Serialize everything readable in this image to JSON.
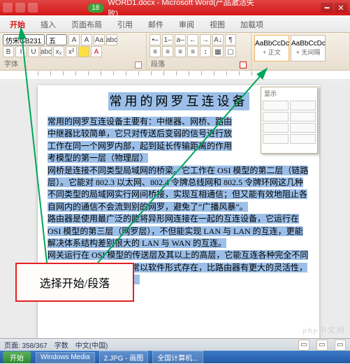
{
  "title": {
    "badge": "18",
    "doc": "WORD1.docx - Microsoft Word(产品激活失败)"
  },
  "tabs": [
    "开始",
    "插入",
    "页面布局",
    "引用",
    "邮件",
    "审阅",
    "视图",
    "加载项"
  ],
  "font": {
    "name": "仿宋GB2312",
    "size": "五"
  },
  "rbtn": {
    "b": "B",
    "i": "I",
    "u": "U",
    "s": "abc",
    "x2": "x²",
    "x1": "x₂",
    "clr": "abc",
    "aa": "Aa",
    "al": "≡",
    "ac": "≡",
    "ar": "≡",
    "aj": "≡",
    "bl": "•–",
    "nl": "1–",
    "il": "a–",
    "sh": "▦",
    "bd": "▢",
    "a1": "A",
    "a2": "A"
  },
  "group_labels": {
    "font": "字体",
    "para": "段落"
  },
  "styles": [
    {
      "preview": "AaBbCcDc",
      "name": "+ 正文"
    },
    {
      "preview": "AaBbCcDc",
      "name": "+ 无间隔"
    }
  ],
  "float_hdr": "显示",
  "doc": {
    "title": "常用的网罗互连设备",
    "p1": "常用的网罗互连设备主要有：中继器、网桥、路由",
    "p2": "中继器比较简单，它只对传送后变弱的信号进行放",
    "p3": "工作在同一个网罗内部，起到延长传输距离的作用",
    "p4": "考模型的第一层（物理层）",
    "p5": "网桥是连接不同类型局域网的桥梁。它工作在 OSI 模型的第二层（链路层）。它能对 802.3 以太网、802.4 令牌总线网和 802.5 令牌环网这几种不同类型的局域网实行网间桥接，实现互相通信；但又能有效地阻止各自网内的通信不会流到别的网罗，避免了“广播风暴”。",
    "p6": "路由器是使用最广泛的能将异形网连接在一起的互连设备，它运行在 OSI 模型的第三层（网罗层），不但能实现 LAN 与 LAN 的互连，更能解决体系结构差别很大的 LAN 与 WAN 的互连。",
    "p7": "网关运行在 OSI 模型的传送层及其以上的高层，它能互连各种完全不同体系结构的网罗。它通常以软件形式存在，比路由器有更大的灵活性，但也更复杂，开销更大。"
  },
  "callout": "选择开始/段落",
  "status": {
    "pages": "页面: 358/367",
    "words": "字数",
    "lang": "中文(中国)"
  },
  "task": {
    "start": "开始",
    "t1": "Windows Media",
    "t2": "2.JPG - 画图",
    "t3": "全国计算机..."
  },
  "watermark": "php中文网"
}
